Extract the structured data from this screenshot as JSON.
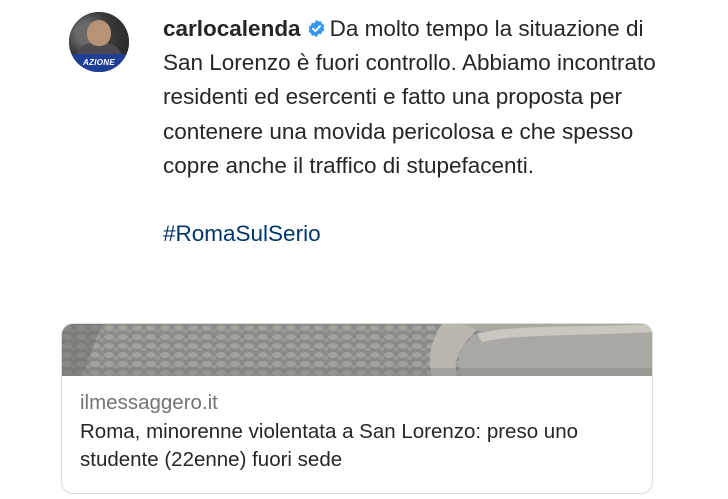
{
  "post": {
    "avatar_label": "AZIONE",
    "username": "carlocalenda",
    "caption": "Da molto tempo la situazione di San Lorenzo è fuori controllo. Abbiamo incontrato residenti ed esercenti e fatto una proposta per contenere una movida pericolosa e che spesso copre anche il traffico di stupefacenti.",
    "hashtag": "#RomaSulSerio"
  },
  "link_card": {
    "domain": "ilmessaggero.it",
    "headline": "Roma, minorenne violentata a San Lorenzo: preso uno studente (22enne) fuori sede"
  },
  "colors": {
    "verified_badge": "#3897f0",
    "hashtag": "#00376b",
    "avatar_band": "#1f3f96"
  }
}
